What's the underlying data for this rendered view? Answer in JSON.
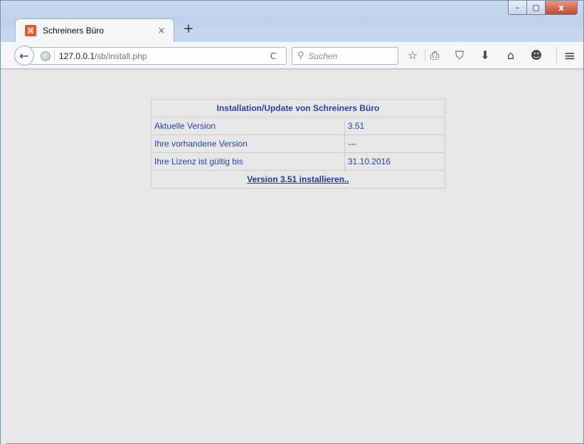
{
  "window": {
    "controls": {
      "minimize": "–",
      "maximize": "▢",
      "close": "x"
    }
  },
  "tab": {
    "title": "Schreiners Büro",
    "favicon": "⌘",
    "close": "×",
    "new_tab": "+"
  },
  "navbar": {
    "back": "←",
    "url_host": "127.0.0.1",
    "url_path": "/sb/install.php",
    "reload": "C",
    "search_placeholder": "Suchen",
    "search_icon": "⚲",
    "icons": {
      "bookmark_star": "☆",
      "reading_list": "⎙",
      "pocket": "⛉",
      "download": "⬇",
      "home": "⌂",
      "chat": "☻",
      "menu": "≡"
    }
  },
  "page": {
    "header": "Installation/Update von Schreiners Büro",
    "rows": [
      {
        "label": "Aktuelle Version",
        "value": "3.51"
      },
      {
        "label": "Ihre vorhandene Version",
        "value": "---"
      },
      {
        "label": "Ihre Lizenz ist gültig bis",
        "value": "31.10.2016"
      }
    ],
    "install_link": "Version 3.51 installieren.."
  }
}
